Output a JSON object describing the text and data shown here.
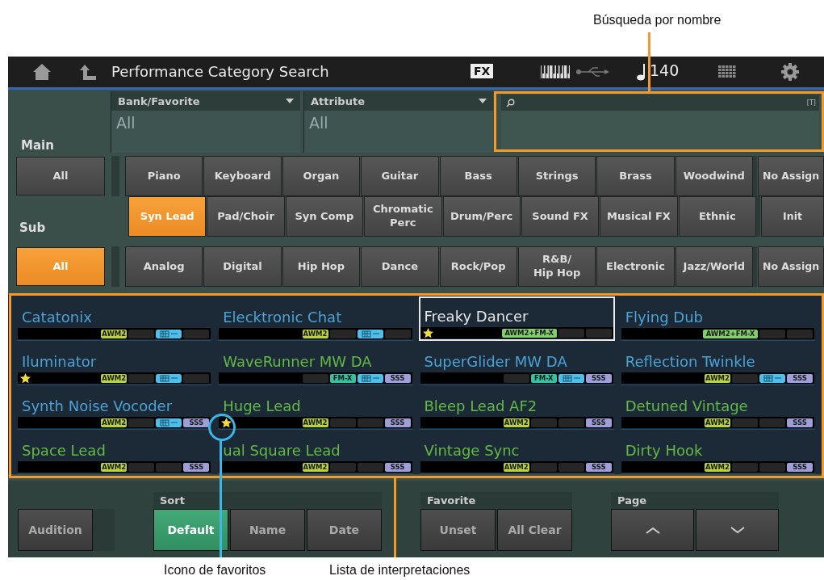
{
  "topbar": {
    "title": "Performance Category Search",
    "fx_badge": "FX",
    "tempo": "140"
  },
  "filters": {
    "main_label": "Main",
    "sub_label": "Sub",
    "bank": {
      "label": "Bank/Favorite",
      "value": "All"
    },
    "attribute": {
      "label": "Attribute",
      "value": "All"
    },
    "search": {
      "tag": "[T]"
    }
  },
  "main_all": {
    "label": "All",
    "selected": false
  },
  "main_categories": [
    {
      "label": "Piano",
      "selected": false
    },
    {
      "label": "Keyboard",
      "selected": false
    },
    {
      "label": "Organ",
      "selected": false
    },
    {
      "label": "Guitar",
      "selected": false
    },
    {
      "label": "Bass",
      "selected": false
    },
    {
      "label": "Strings",
      "selected": false
    },
    {
      "label": "Brass",
      "selected": false
    },
    {
      "label": "Woodwind",
      "selected": false
    },
    {
      "label": "Syn Lead",
      "selected": true
    },
    {
      "label": "Pad/Choir",
      "selected": false
    },
    {
      "label": "Syn Comp",
      "selected": false
    },
    {
      "label": "Chromatic\nPerc",
      "selected": false
    },
    {
      "label": "Drum/Perc",
      "selected": false
    },
    {
      "label": "Sound FX",
      "selected": false
    },
    {
      "label": "Musical FX",
      "selected": false
    },
    {
      "label": "Ethnic",
      "selected": false
    }
  ],
  "main_extra": [
    {
      "label": "No Assign",
      "selected": false
    },
    {
      "label": "Init",
      "selected": false
    }
  ],
  "sub_all": {
    "label": "All",
    "selected": true
  },
  "sub_categories": [
    {
      "label": "Analog",
      "selected": false
    },
    {
      "label": "Digital",
      "selected": false
    },
    {
      "label": "Hip Hop",
      "selected": false
    },
    {
      "label": "Dance",
      "selected": false
    },
    {
      "label": "Rock/Pop",
      "selected": false
    },
    {
      "label": "R&B/\nHip Hop",
      "selected": false
    },
    {
      "label": "Electronic",
      "selected": false
    },
    {
      "label": "Jazz/World",
      "selected": false
    }
  ],
  "sub_extra": {
    "label": "No Assign",
    "selected": false
  },
  "performances": [
    {
      "name": "Catatonix",
      "color": "#4aa3d4",
      "selected": false,
      "favorite": false,
      "tags": [
        {
          "kind": "awm",
          "label": "AWM2"
        },
        {
          "kind": "empty"
        },
        {
          "kind": "mc"
        },
        {
          "kind": "empty"
        }
      ]
    },
    {
      "name": "Elecktronic Chat",
      "color": "#4aa3d4",
      "selected": false,
      "favorite": false,
      "tags": [
        {
          "kind": "awm",
          "label": "AWM2"
        },
        {
          "kind": "empty"
        },
        {
          "kind": "mc"
        },
        {
          "kind": "empty"
        }
      ]
    },
    {
      "name": "Freaky Dancer",
      "selected": true,
      "favorite": true,
      "tags": [
        {
          "kind": "awmfmx",
          "label": "AWM2+FM-X"
        },
        {
          "kind": "empty"
        },
        {
          "kind": "empty"
        }
      ]
    },
    {
      "name": "Flying Dub",
      "color": "#4aa3d4",
      "selected": false,
      "favorite": false,
      "tags": [
        {
          "kind": "awmfmx",
          "label": "AWM2+FM-X"
        },
        {
          "kind": "empty"
        },
        {
          "kind": "empty"
        }
      ]
    },
    {
      "name": "Iluminator",
      "color": "#4aa3d4",
      "selected": false,
      "favorite": true,
      "tags": [
        {
          "kind": "awm",
          "label": "AWM2"
        },
        {
          "kind": "empty"
        },
        {
          "kind": "mc"
        },
        {
          "kind": "empty"
        }
      ]
    },
    {
      "name": "WaveRunner MW DA",
      "color": "#63b946",
      "selected": false,
      "favorite": false,
      "tags": [
        {
          "kind": "empty"
        },
        {
          "kind": "fmx",
          "label": "FM-X"
        },
        {
          "kind": "mc"
        },
        {
          "kind": "sss",
          "label": "SSS"
        }
      ]
    },
    {
      "name": "SuperGlider MW DA",
      "color": "#4aa3d4",
      "selected": false,
      "favorite": false,
      "tags": [
        {
          "kind": "empty"
        },
        {
          "kind": "fmx",
          "label": "FM-X"
        },
        {
          "kind": "mc"
        },
        {
          "kind": "sss",
          "label": "SSS"
        }
      ]
    },
    {
      "name": "Reflection Twinkle",
      "color": "#4aa3d4",
      "selected": false,
      "favorite": false,
      "tags": [
        {
          "kind": "awm",
          "label": "AWM2"
        },
        {
          "kind": "empty"
        },
        {
          "kind": "mc"
        },
        {
          "kind": "sss",
          "label": "SSS"
        }
      ]
    },
    {
      "name": "Synth Noise Vocoder",
      "color": "#4aa3d4",
      "selected": false,
      "favorite": false,
      "tags": [
        {
          "kind": "awm",
          "label": "AWM2"
        },
        {
          "kind": "empty"
        },
        {
          "kind": "mc"
        },
        {
          "kind": "sss",
          "label": "SSS"
        }
      ]
    },
    {
      "name": "Huge Lead",
      "color": "#63b946",
      "selected": false,
      "favorite": true,
      "tags": [
        {
          "kind": "awm",
          "label": "AWM2"
        },
        {
          "kind": "empty"
        },
        {
          "kind": "empty"
        },
        {
          "kind": "sss",
          "label": "SSS"
        }
      ]
    },
    {
      "name": "Bleep Lead AF2",
      "color": "#63b946",
      "selected": false,
      "favorite": false,
      "tags": [
        {
          "kind": "awm",
          "label": "AWM2"
        },
        {
          "kind": "empty"
        },
        {
          "kind": "empty"
        },
        {
          "kind": "sss",
          "label": "SSS"
        }
      ]
    },
    {
      "name": "Detuned Vintage",
      "color": "#63b946",
      "selected": false,
      "favorite": false,
      "tags": [
        {
          "kind": "awm",
          "label": "AWM2"
        },
        {
          "kind": "empty"
        },
        {
          "kind": "empty"
        },
        {
          "kind": "sss",
          "label": "SSS"
        }
      ]
    },
    {
      "name": "Space Lead",
      "color": "#63b946",
      "selected": false,
      "favorite": false,
      "tags": [
        {
          "kind": "awm",
          "label": "AWM2"
        },
        {
          "kind": "empty"
        },
        {
          "kind": "empty"
        },
        {
          "kind": "sss",
          "label": "SSS"
        }
      ]
    },
    {
      "name": "ual Square Lead",
      "color": "#63b946",
      "selected": false,
      "favorite": false,
      "tags": [
        {
          "kind": "awm",
          "label": "AWM2"
        },
        {
          "kind": "empty"
        },
        {
          "kind": "empty"
        },
        {
          "kind": "sss",
          "label": "SSS"
        }
      ]
    },
    {
      "name": "Vintage Sync",
      "color": "#63b946",
      "selected": false,
      "favorite": false,
      "tags": [
        {
          "kind": "awm",
          "label": "AWM2"
        },
        {
          "kind": "empty"
        },
        {
          "kind": "empty"
        },
        {
          "kind": "sss",
          "label": "SSS"
        }
      ]
    },
    {
      "name": "Dirty Hook",
      "color": "#63b946",
      "selected": false,
      "favorite": false,
      "tags": [
        {
          "kind": "awm",
          "label": "AWM2"
        },
        {
          "kind": "empty"
        },
        {
          "kind": "empty"
        },
        {
          "kind": "sss",
          "label": "SSS"
        }
      ]
    }
  ],
  "bottom": {
    "audition": "Audition",
    "sort_label": "Sort",
    "sort": [
      {
        "label": "Default",
        "selected": true
      },
      {
        "label": "Name",
        "selected": false
      },
      {
        "label": "Date",
        "selected": false
      }
    ],
    "favorite_label": "Favorite",
    "favorite": [
      {
        "label": "Unset"
      },
      {
        "label": "All Clear"
      }
    ],
    "page_label": "Page"
  },
  "annotations": [
    {
      "kind": "search",
      "text": "Búsqueda por nombre"
    },
    {
      "kind": "favorite",
      "text": "Icono de favoritos"
    },
    {
      "kind": "list",
      "text": "Lista de interpretaciones"
    }
  ]
}
